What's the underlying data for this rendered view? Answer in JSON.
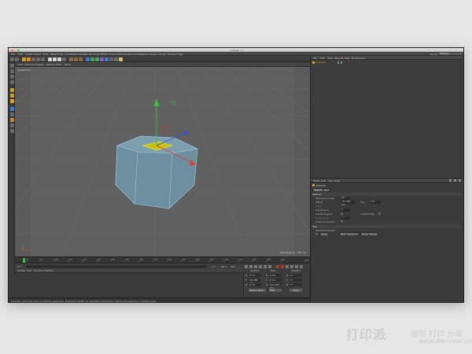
{
  "window": {
    "title": "Untitled 1 *",
    "lights": [
      "#ff5f57",
      "#febc2e",
      "#28c840"
    ]
  },
  "menubar": {
    "items": [
      "File",
      "Edit",
      "Create",
      "Select",
      "Tools",
      "Mesh",
      "Snap",
      "Animate",
      "Simulate",
      "Render",
      "Sculpt",
      "Motion Tracker",
      "MoGraph",
      "Character",
      "Pipeline",
      "Plugins",
      "Script",
      "Window",
      "Help"
    ],
    "layout_label": "Layout:",
    "layout_value": "Startup"
  },
  "viewport": {
    "menu": [
      "View",
      "Cameras",
      "Display",
      "Options",
      "Filter",
      "Panel"
    ],
    "label": "Perspective",
    "grid_spacing": "Grid Spacing : 100 cm",
    "colors": {
      "background": "#5b5b5b",
      "object": "#6e8fa0",
      "selection": "#c8c40a",
      "x_axis": "#e33b2e",
      "y_axis": "#35c03d",
      "z_axis": "#2e53e3"
    }
  },
  "timeline": {
    "ticks": [
      "0",
      "5",
      "10",
      "15",
      "20",
      "25",
      "30",
      "35",
      "40",
      "45",
      "50",
      "55",
      "60",
      "65",
      "70",
      "75",
      "80",
      "85",
      "90"
    ],
    "end_frame": "0 F"
  },
  "playback": {
    "start": "0 F",
    "current": "0 F",
    "end": "90 F",
    "end2": "90 F"
  },
  "materials": {
    "menu": [
      "Create",
      "Edit",
      "Function",
      "Texture"
    ]
  },
  "coordinates": {
    "headers": [
      "Position",
      "Size",
      "Rotation"
    ],
    "rows": [
      {
        "axis": "X",
        "pos": "0 cm",
        "size_axis": "X",
        "size": "0 cm",
        "rot_axis": "H",
        "rot": "0 °"
      },
      {
        "axis": "Y",
        "pos": "59.282 cm",
        "size_axis": "Y",
        "size": "0 cm",
        "rot_axis": "P",
        "rot": "0 °"
      },
      {
        "axis": "Z",
        "pos": "0 cm",
        "size_axis": "Z",
        "size": "103.923 cm",
        "rot_axis": "B",
        "rot": "0 °"
      }
    ],
    "mode": "Object (Rel)",
    "size_mode": "Size",
    "apply": "Apply"
  },
  "status": {
    "text": "Extrude: Click and drag to extrude elements. Hold down SHIFT to quantize movement / add to the selection in point mode."
  },
  "object_manager": {
    "menu": [
      "File",
      "Edit",
      "View",
      "Objects",
      "Tags",
      "Bookmarks"
    ],
    "object_name": "Cylinder"
  },
  "attributes": {
    "menu": [
      "Mode",
      "Edit",
      "User Data"
    ],
    "title": "Extrude",
    "tabs": [
      "Options",
      "Tool"
    ],
    "section": "Options",
    "fields": {
      "max_angle_label": "Maximum Angle",
      "max_angle_value": "89 °",
      "offset_label": "Offset",
      "offset_value": "-21.065 cm",
      "var_label": "Var.",
      "var_value": "0 %",
      "bevel_label": "Bevel",
      "subdivision_label": "Subdivision",
      "subdivision_value": "0",
      "create_ngons_label": "Create N-gons",
      "create_caps_label": "Create Caps",
      "edge_angle_label": "Edge Angle",
      "edge_angle_value": "0 °",
      "preserve_groups_label": "Preserve Groups"
    },
    "tool_section": "Tool",
    "realtime_label": "Realtime Update",
    "buttons": [
      "Apply",
      "New Transform",
      "Reset Values"
    ]
  },
  "watermark": {
    "cn": "打印派",
    "cn2": "模型 打印 分享",
    "url": "www.dayinpai.com"
  }
}
